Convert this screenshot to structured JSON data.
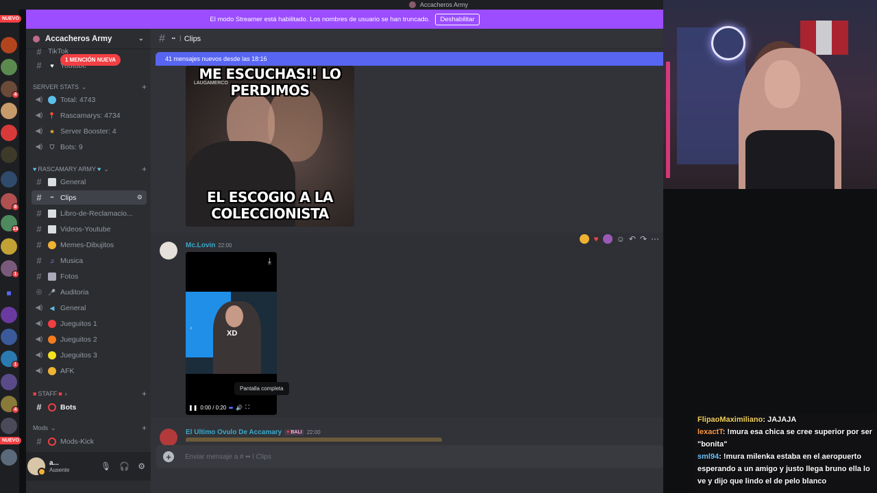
{
  "window": {
    "title": "Accacheros Army"
  },
  "streamer_banner": {
    "text": "El modo Streamer está habilitado. Los nombres de usuario se han truncado.",
    "button": "Deshabilitar"
  },
  "rail": {
    "nuevo_top": "NUEVO",
    "nuevo_bottom": "NUEVO",
    "badges": [
      "4",
      "3",
      "8",
      "13",
      "1",
      "1",
      "4"
    ]
  },
  "sidebar": {
    "server_name": "Accacheros Army",
    "mention_pill": "1 MENCIÓN NUEVA",
    "partial_top": "TikTok",
    "youtube": "Youtube",
    "cat_stats": "SERVER STATS",
    "total": "Total: 4743",
    "rascamarys": "Rascamarys: 4734",
    "boosters": "Server Booster: 4",
    "bots": "Bots: 9",
    "cat_army": "RASCAMARY ARMY",
    "channels": [
      "General",
      "Clips",
      "Libro-de-Reclamacio...",
      "Videos-Youtube",
      "Memes-Dibujitos",
      "Musica",
      "Fotos",
      "Auditoria",
      "General",
      "Jueguitos 1",
      "Jueguitos 2",
      "Jueguitos 3",
      "AFK"
    ],
    "cat_staff": "STAFF",
    "staff_bots": "Bots",
    "cat_mods": "Mods",
    "mods_kick": "Mods-Kick",
    "user": {
      "name": "a...",
      "status": "Ausente"
    }
  },
  "main": {
    "channel_name": "Clips",
    "new_messages": "41 mensajes nuevos desde las 18:16",
    "meme": {
      "top": "ME ESCUCHAS!! LO PERDIMOS",
      "bottom": "EL ESCOGIO A LA COLECCIONISTA",
      "watermark": "LAUGAMERCO"
    },
    "msg1": {
      "author": "Mc.Lovin",
      "time": "22:00"
    },
    "video": {
      "overlay": "XD",
      "time": "0:00 / 0:20",
      "tooltip": "Pantalla completa"
    },
    "msg2": {
      "author": "El Ultimo Ovulo De Accamary",
      "badge": "BALI",
      "time": "22:00"
    },
    "composer_placeholder": "Enviar mensaje a # ▪▪ ǀ Clips"
  },
  "chat": [
    {
      "user": "FlipaoMaximiliano",
      "text": ": JAJAJA"
    },
    {
      "user": "lexactT",
      "text": ": !mura esa chica se cree superior por ser \"bonita\""
    },
    {
      "user": "sml94",
      "text": ": !mura milenka estaba en el aeropuerto esperando a un amigo y justo llega bruno ella lo ve y dijo que lindo el de pelo blanco"
    }
  ],
  "colors": {
    "streamer_bar": "#9b4dff",
    "new_bar": "#5865f2",
    "mention": "#f23f43",
    "sidebar": "#2b2d31",
    "main": "#313338"
  }
}
